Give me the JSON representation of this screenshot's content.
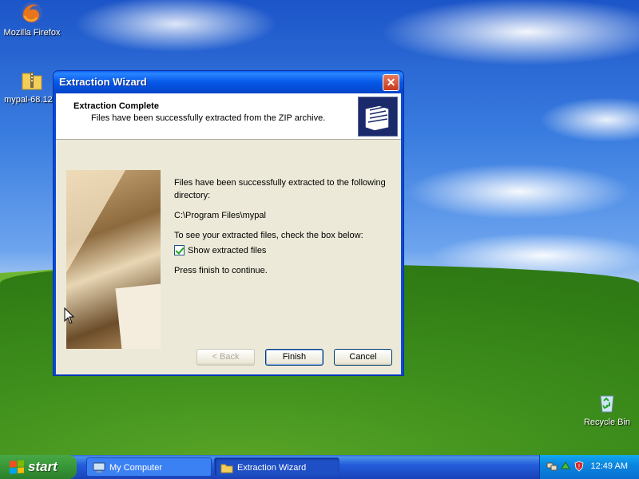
{
  "desktop": {
    "icons": [
      {
        "label": "Mozilla Firefox"
      },
      {
        "label": "mypal-68.12..."
      },
      {
        "label": "Recycle Bin"
      }
    ]
  },
  "window": {
    "title": "Extraction Wizard",
    "close_label": "✕",
    "header": {
      "title": "Extraction Complete",
      "subtitle": "Files have been successfully extracted from the ZIP archive."
    },
    "body": {
      "line1": "Files have been successfully extracted to the following directory:",
      "path": "C:\\Program Files\\mypal",
      "line2": "To see your extracted files, check the box below:",
      "checkbox_label": "Show extracted files",
      "checkbox_checked": true,
      "line3": "Press finish to continue."
    },
    "buttons": {
      "back": "< Back",
      "finish": "Finish",
      "cancel": "Cancel"
    }
  },
  "taskbar": {
    "start_label": "start",
    "tasks": [
      {
        "label": "My Computer",
        "icon": "my-computer-icon"
      },
      {
        "label": "Extraction Wizard",
        "icon": "folder-icon"
      }
    ],
    "clock": "12:49 AM"
  }
}
